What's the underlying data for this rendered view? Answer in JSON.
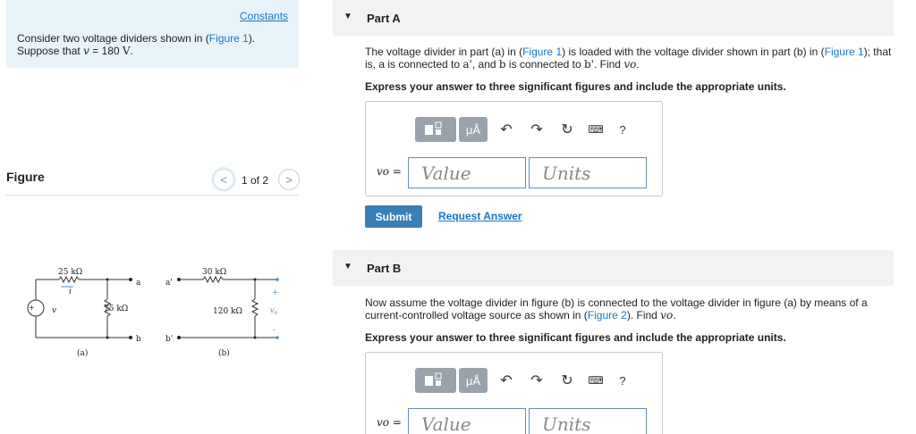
{
  "problem": {
    "constants_link": "Constants",
    "line1_pre": "Consider two voltage dividers shown in (",
    "line1_link": "Figure 1",
    "line1_post": ").",
    "line2_pre": "Suppose that ",
    "line2_var": "v",
    "line2_mid": " = 180 ",
    "line2_unit": "V",
    "line2_post": "."
  },
  "figure": {
    "title": "Figure",
    "page_count": "1 of 2",
    "prev_glyph": "<",
    "next_glyph": ">",
    "circuit_labels": {
      "r1": "25 kΩ",
      "r2": "75 kΩ",
      "r3": "30 kΩ",
      "r4": "120 kΩ",
      "source": "v",
      "current": "i",
      "node_a": "a",
      "node_b": "b",
      "node_a_prime": "a'",
      "node_b_prime": "b'",
      "vo": "v",
      "vo_sub": "o",
      "plus": "+",
      "minus": "-",
      "cap_a": "(a)",
      "cap_b": "(b)"
    }
  },
  "partA": {
    "title": "Part A",
    "text_1": "The voltage divider in part (a) in (",
    "link_1": "Figure 1",
    "text_2": ") is loaded with the voltage divider shown in part (b) in (",
    "link_2": "Figure 1",
    "text_3": "); that is, a is connected to ",
    "ap": "a'",
    "text_4": ", and ",
    "b": "b",
    "text_5": " is connected to ",
    "bp": "b'",
    "text_6": ". Find ",
    "vo": "vo",
    "text_7": ".",
    "instruction": "Express your answer to three significant figures and include the appropriate units.",
    "label": "vo =",
    "value_placeholder": "Value",
    "units_placeholder": "Units",
    "submit": "Submit",
    "request": "Request Answer"
  },
  "partB": {
    "title": "Part B",
    "text_1": "Now assume the voltage divider in figure (b) is connected to the voltage divider in figure (a) by means of a current-controlled voltage source as shown in (",
    "link_1": "Figure 2",
    "text_2": "). Find ",
    "vo": "vo",
    "text_3": ".",
    "instruction": "Express your answer to three significant figures and include the appropriate units.",
    "label": "vo =",
    "value_placeholder": "Value",
    "units_placeholder": "Units"
  },
  "toolbar": {
    "mu_label": "μÅ",
    "help_label": "?",
    "icons": [
      "templates-icon",
      "units-icon",
      "undo-icon",
      "redo-icon",
      "reset-icon",
      "keyboard-icon",
      "help-icon"
    ]
  }
}
